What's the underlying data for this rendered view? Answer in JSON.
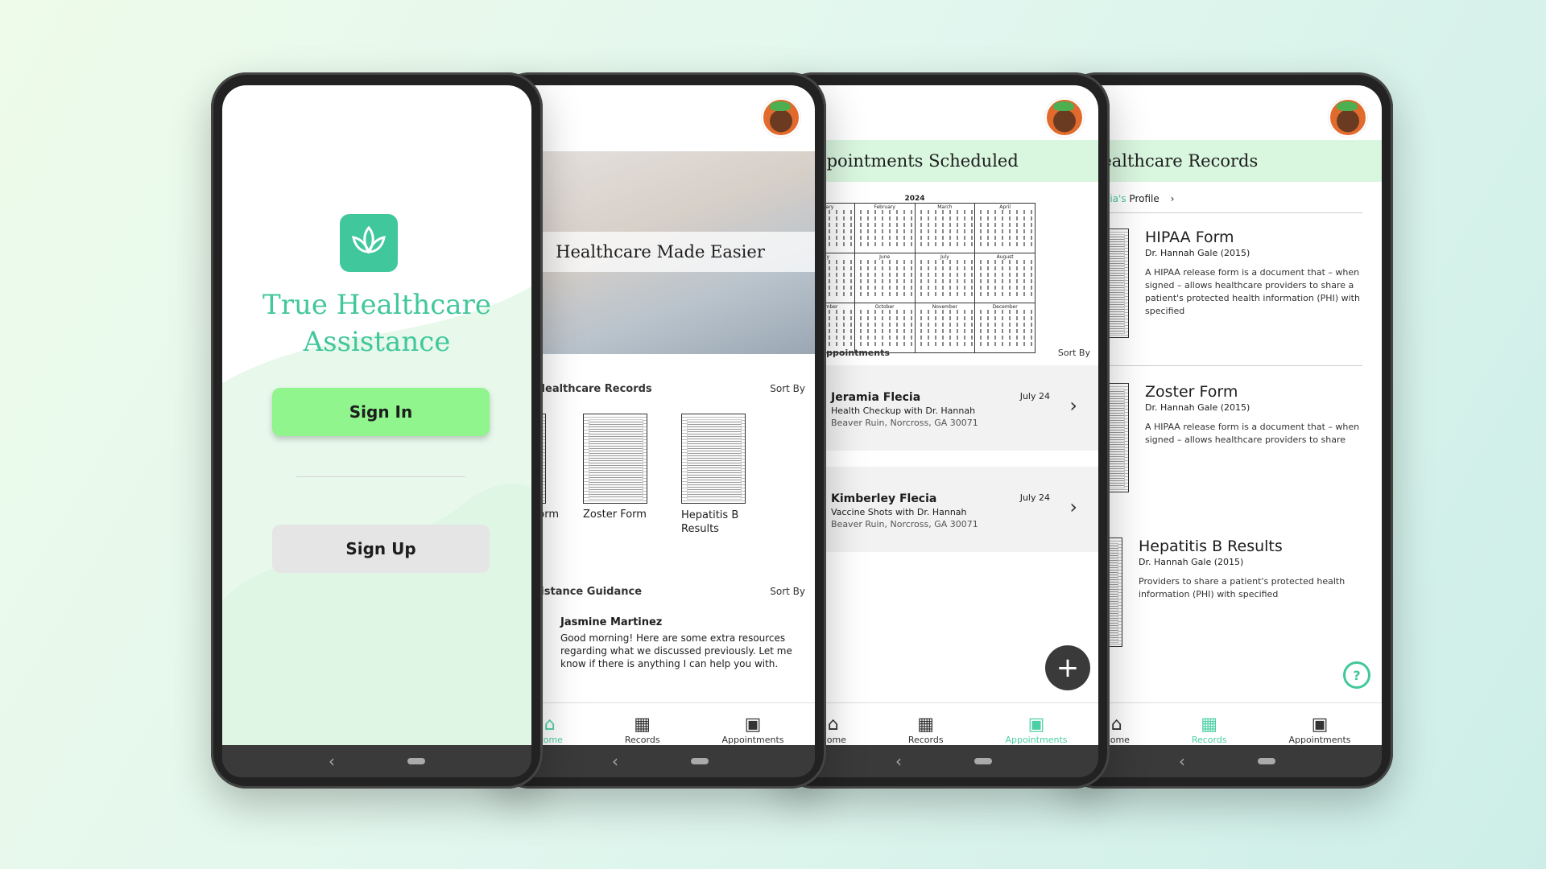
{
  "colors": {
    "brand_green": "#41c79c",
    "accent_green": "#8ff58c",
    "pale_green": "#d9f6df",
    "active_nav": "#4ccfa5"
  },
  "screen1": {
    "app_name_line1": "True Healthcare",
    "app_name_line2": "Assistance",
    "sign_in": "Sign In",
    "sign_up": "Sign Up",
    "logo_icon": "lotus-icon"
  },
  "screen2": {
    "hero_title": "Healthcare Made Easier",
    "records_title": "nted Healthcare Records",
    "records_sort": "Sort By",
    "records": [
      {
        "label": "AA Form"
      },
      {
        "label": "Zoster Form"
      },
      {
        "label": "Hepatitis B Results"
      }
    ],
    "guidance_title": "al Assistance Guidance",
    "guidance_sort": "Sort By",
    "message": {
      "name": "Jasmine Martinez",
      "text": "Good morning! Here are some extra resources regarding what we discussed previously. Let me know if there is anything I can help you with."
    }
  },
  "screen3": {
    "title": "Appointments Scheduled",
    "calendar_year": "2024",
    "months": [
      "January",
      "February",
      "March",
      "April",
      "May",
      "June",
      "July",
      "August",
      "September",
      "October",
      "November",
      "December"
    ],
    "upcoming_title": "ching Appointments",
    "upcoming_sort": "Sort By",
    "appointments": [
      {
        "name": "Jeramia Flecia",
        "date": "July 24",
        "desc": "Health Checkup with Dr. Hannah",
        "address": "Beaver Ruin, Norcross, GA 30071"
      },
      {
        "name": "Kimberley Flecia",
        "date": "July 24",
        "desc": "Vaccine Shots with Dr. Hannah",
        "address": "Beaver Ruin, Norcross, GA 30071"
      }
    ]
  },
  "screen4": {
    "title": "Healthcare Records",
    "breadcrumb_prefix": "g",
    "breadcrumb_link": "Jeramia's",
    "breadcrumb_suffix": "Profile",
    "records": [
      {
        "title": "HIPAA Form",
        "doctor": "Dr. Hannah Gale (2015)",
        "desc": "A HIPAA release form is a document that – when signed – allows healthcare providers to share a patient's protected health information (PHI) with specified"
      },
      {
        "title": "Zoster Form",
        "doctor": "Dr. Hannah Gale (2015)",
        "desc": "A HIPAA release form is a document that – when signed – allows healthcare providers to share"
      },
      {
        "title": "Hepatitis B Results",
        "doctor": "Dr. Hannah Gale (2015)",
        "desc": "Providers to share a patient's protected health information (PHI) with specified"
      }
    ]
  },
  "nav": {
    "home": "Home",
    "records": "Records",
    "appointments": "Appointments"
  }
}
